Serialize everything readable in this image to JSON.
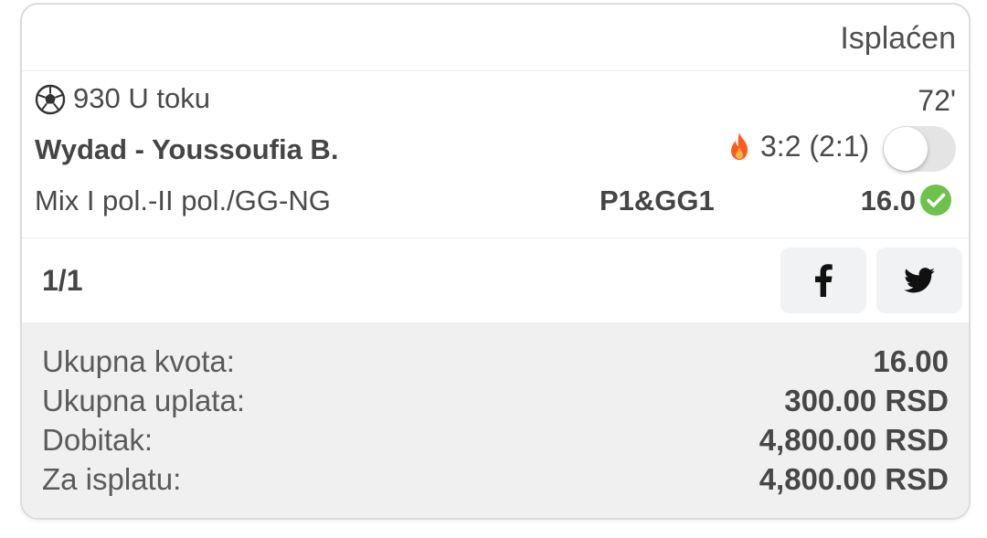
{
  "ticket": {
    "status": "Isplaćen"
  },
  "event": {
    "code_status": "930 U toku",
    "minute": "72'",
    "teams": "Wydad - Youssoufia B.",
    "score": "3:2 (2:1)",
    "market": "Mix I pol.-II pol./GG-NG",
    "pick": "P1&GG1",
    "odd": "16.0",
    "sport_icon": "soccer-ball-icon",
    "hot_icon": "fire-icon",
    "result_icon": "check-circle-icon",
    "colors": {
      "fire": "#ff5a1f",
      "check": "#6cc24a",
      "toggle_track": "#e4e4e4"
    }
  },
  "share": {
    "counter": "1/1",
    "facebook_icon": "facebook-icon",
    "twitter_icon": "twitter-icon"
  },
  "totals": [
    {
      "label": "Ukupna kvota:",
      "value": "16.00"
    },
    {
      "label": "Ukupna uplata:",
      "value": "300.00 RSD"
    },
    {
      "label": "Dobitak:",
      "value": "4,800.00 RSD"
    },
    {
      "label": "Za isplatu:",
      "value": "4,800.00 RSD"
    }
  ]
}
